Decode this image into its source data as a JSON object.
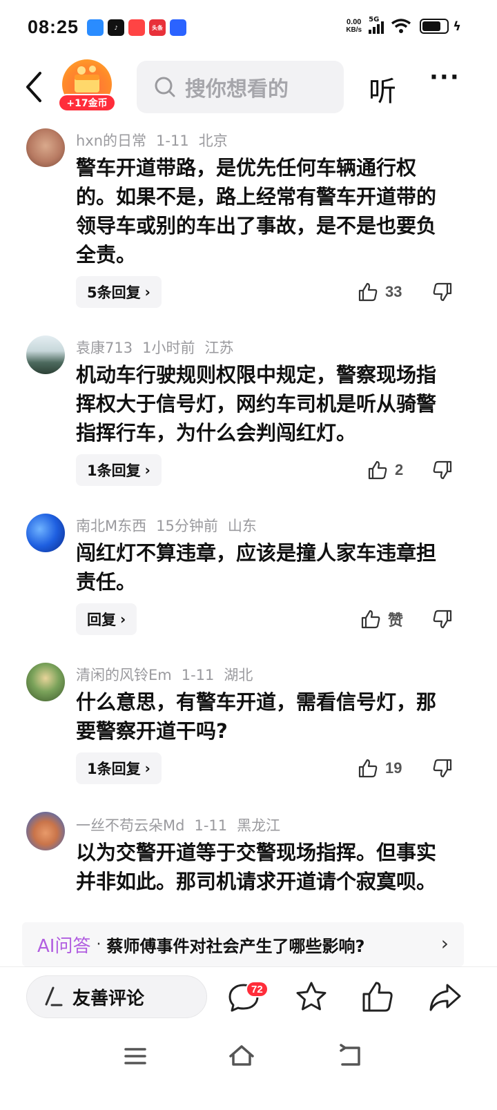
{
  "status_bar": {
    "time": "08:25",
    "app_icons": [
      {
        "name": "app-icon-1",
        "color": "#2a8cff"
      },
      {
        "name": "tiktok-icon",
        "color": "#111111"
      },
      {
        "name": "app-icon-3",
        "color": "#ff4444"
      },
      {
        "name": "toutiao-icon",
        "color": "#e8313a",
        "text": "头条"
      },
      {
        "name": "baidu-icon",
        "color": "#2b63ff"
      }
    ],
    "net_speed_value": "0.00",
    "net_speed_unit": "KB/s",
    "network": "5G"
  },
  "top_nav": {
    "coin_label": "+17金币",
    "search_placeholder": "搜你想看的",
    "listen_label": "听",
    "more_label": "···"
  },
  "comments": [
    {
      "user": "hxn的日常",
      "date": "1-11",
      "location": "北京",
      "text": "警车开道带路，是优先任何车辆通行权的。如果不是，路上经常有警车开道带的领导车或别的车出了事故，是不是也要负全责。",
      "reply_label": "5条回复",
      "likes": "33"
    },
    {
      "user": "袁康713",
      "date": "1小时前",
      "location": "江苏",
      "text": "机动车行驶规则权限中规定，警察现场指挥权大于信号灯，网约车司机是听从骑警指挥行车，为什么会判闯红灯。",
      "reply_label": "1条回复",
      "likes": "2"
    },
    {
      "user": "南北M东西",
      "date": "15分钟前",
      "location": "山东",
      "text": "闯红灯不算违章，应该是撞人家车违章担责任。",
      "reply_label": "回复",
      "likes": "赞"
    },
    {
      "user": "清闲的风铃Em",
      "date": "1-11",
      "location": "湖北",
      "text": "什么意思，有警车开道，需看信号灯，那要警察开道干吗?",
      "reply_label": "1条回复",
      "likes": "19"
    },
    {
      "user": "一丝不苟云朵Md",
      "date": "1-11",
      "location": "黑龙江",
      "text": "以为交警开道等于交警现场指挥。但事实并非如此。那司机请求开道请个寂寞呗。"
    }
  ],
  "ai_banner": {
    "tag": "AI问答",
    "separator": "·",
    "question": "蔡师傅事件对社会产生了哪些影响?"
  },
  "bottom_bar": {
    "comment_placeholder": "友善评论",
    "comment_count": "72"
  },
  "colors": {
    "accent_red": "#ff2d3a",
    "ai_purple": "#b15ee0",
    "meta_gray": "#9a9a9e"
  }
}
